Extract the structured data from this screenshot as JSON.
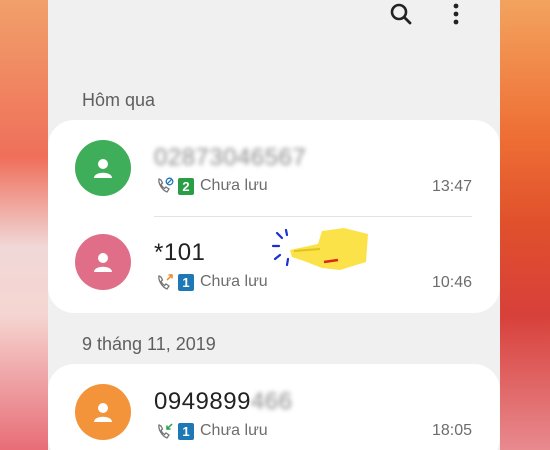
{
  "sections": [
    {
      "header": "Hôm qua"
    },
    {
      "header": "9 tháng 11, 2019"
    }
  ],
  "calls": [
    {
      "number": "02873046567",
      "sim": "2",
      "status": "Chưa lưu",
      "time": "13:47",
      "avatar_color": "#3fae5a",
      "call_type": "blocked-call-icon"
    },
    {
      "number": "*101",
      "sim": "1",
      "status": "Chưa lưu",
      "time": "10:46",
      "avatar_color": "#e06e88",
      "call_type": "outgoing-call-icon"
    },
    {
      "number_visible": "0949899",
      "number_blurred": "466",
      "sim": "1",
      "status": "Chưa lưu",
      "time": "18:05",
      "avatar_color": "#f3943a",
      "call_type": "incoming-call-icon"
    }
  ],
  "toolbar": {
    "search": "search-icon",
    "more": "more-options-icon"
  }
}
